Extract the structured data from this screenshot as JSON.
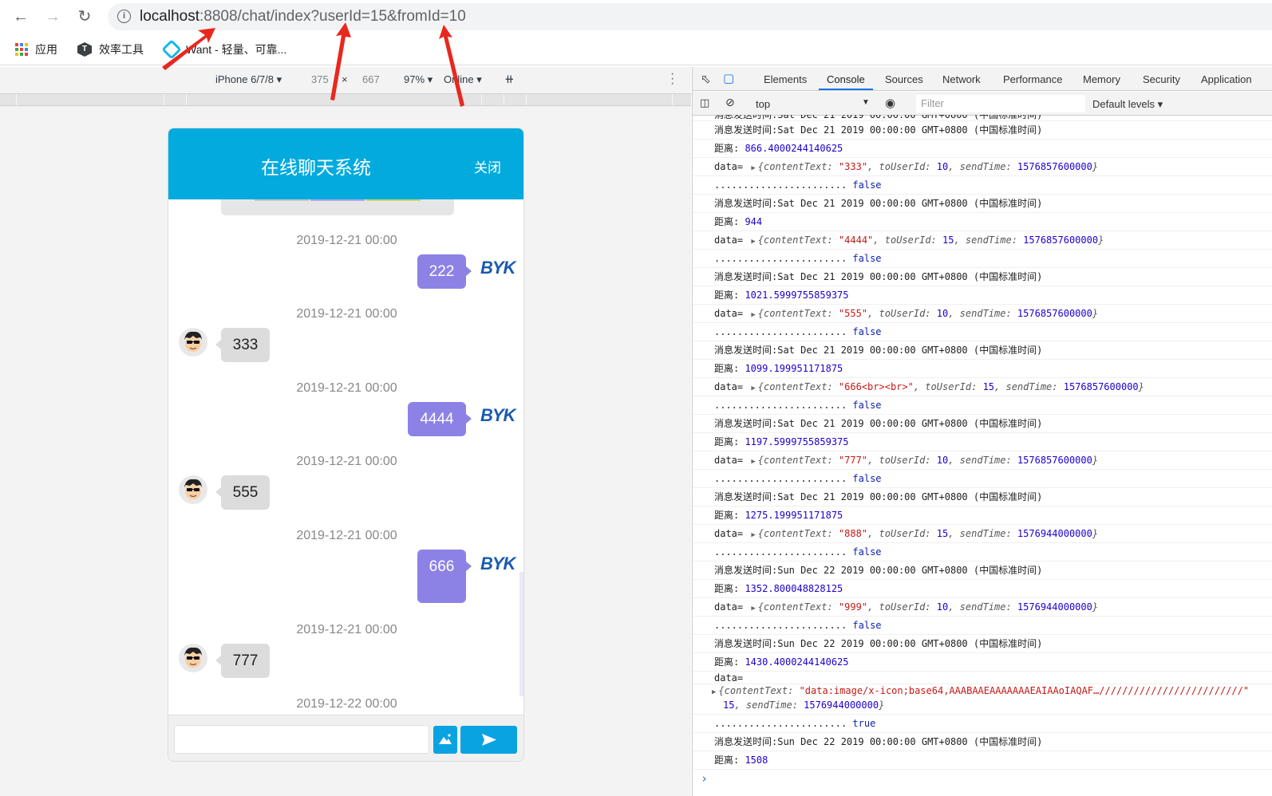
{
  "browser": {
    "url_host": "localhost",
    "url_rest": ":8808/chat/index?userId=15&fromId=10",
    "bookmarks": [
      {
        "label": "应用",
        "icon": "apps-grid-icon"
      },
      {
        "label": "效率工具",
        "icon": "hexagon-t-icon"
      },
      {
        "label": "Want - 轻量、可靠...",
        "icon": "want-logo-icon"
      }
    ]
  },
  "device_toolbar": {
    "device": "iPhone 6/7/8",
    "width": "375",
    "times": "×",
    "height": "667",
    "zoom": "97%",
    "network": "Online"
  },
  "chat": {
    "title": "在线聊天系统",
    "close_label": "关闭",
    "logo_text": "BYK",
    "messages": [
      {
        "time": "2019-12-21 00:00",
        "text": "222",
        "side": "me"
      },
      {
        "time": "2019-12-21 00:00",
        "text": "333",
        "side": "other"
      },
      {
        "time": "2019-12-21 00:00",
        "text": "4444",
        "side": "me"
      },
      {
        "time": "2019-12-21 00:00",
        "text": "555",
        "side": "other"
      },
      {
        "time": "2019-12-21 00:00",
        "text": "666",
        "side": "me"
      },
      {
        "time": "2019-12-21 00:00",
        "text": "777",
        "side": "other"
      },
      {
        "time": "2019-12-22 00:00",
        "text": "",
        "side": "me"
      }
    ]
  },
  "devtools": {
    "tabs": [
      "Elements",
      "Console",
      "Sources",
      "Network",
      "Performance",
      "Memory",
      "Security",
      "Application"
    ],
    "active_tab": "Console",
    "context": "top",
    "filter_placeholder": "Filter",
    "levels": "Default levels",
    "console_lines": [
      {
        "kind": "text",
        "text": "消息发送时间:Sat Dec 21 2019 00:00:00 GMT+0800 (中国标准时间)"
      },
      {
        "kind": "dist",
        "label": "距离: ",
        "value": "866.4000244140625"
      },
      {
        "kind": "data",
        "label": "data= ",
        "content": "\"333\"",
        "toUserId": "10",
        "sendTime": "1576857600000"
      },
      {
        "kind": "dots",
        "dots": ".......................",
        "value": "false"
      },
      {
        "kind": "text",
        "text": "消息发送时间:Sat Dec 21 2019 00:00:00 GMT+0800 (中国标准时间)"
      },
      {
        "kind": "dist",
        "label": "距离: ",
        "value": "944"
      },
      {
        "kind": "data",
        "label": "data= ",
        "content": "\"4444\"",
        "toUserId": "15",
        "sendTime": "1576857600000"
      },
      {
        "kind": "dots",
        "dots": ".......................",
        "value": "false"
      },
      {
        "kind": "text",
        "text": "消息发送时间:Sat Dec 21 2019 00:00:00 GMT+0800 (中国标准时间)"
      },
      {
        "kind": "dist",
        "label": "距离: ",
        "value": "1021.5999755859375"
      },
      {
        "kind": "data",
        "label": "data= ",
        "content": "\"555\"",
        "toUserId": "10",
        "sendTime": "1576857600000"
      },
      {
        "kind": "dots",
        "dots": ".......................",
        "value": "false"
      },
      {
        "kind": "text",
        "text": "消息发送时间:Sat Dec 21 2019 00:00:00 GMT+0800 (中国标准时间)"
      },
      {
        "kind": "dist",
        "label": "距离: ",
        "value": "1099.199951171875"
      },
      {
        "kind": "data",
        "label": "data= ",
        "content": "\"666<br><br>\"",
        "toUserId": "15",
        "sendTime": "1576857600000"
      },
      {
        "kind": "dots",
        "dots": ".......................",
        "value": "false"
      },
      {
        "kind": "text",
        "text": "消息发送时间:Sat Dec 21 2019 00:00:00 GMT+0800 (中国标准时间)"
      },
      {
        "kind": "dist",
        "label": "距离: ",
        "value": "1197.5999755859375"
      },
      {
        "kind": "data",
        "label": "data= ",
        "content": "\"777\"",
        "toUserId": "10",
        "sendTime": "1576857600000"
      },
      {
        "kind": "dots",
        "dots": ".......................",
        "value": "false"
      },
      {
        "kind": "text",
        "text": "消息发送时间:Sat Dec 21 2019 00:00:00 GMT+0800 (中国标准时间)"
      },
      {
        "kind": "dist",
        "label": "距离: ",
        "value": "1275.199951171875"
      },
      {
        "kind": "data",
        "label": "data= ",
        "content": "\"888\"",
        "toUserId": "15",
        "sendTime": "1576944000000"
      },
      {
        "kind": "dots",
        "dots": ".......................",
        "value": "false"
      },
      {
        "kind": "text",
        "text": "消息发送时间:Sun Dec 22 2019 00:00:00 GMT+0800 (中国标准时间)"
      },
      {
        "kind": "dist",
        "label": "距离: ",
        "value": "1352.800048828125"
      },
      {
        "kind": "data",
        "label": "data= ",
        "content": "\"999\"",
        "toUserId": "10",
        "sendTime": "1576944000000"
      },
      {
        "kind": "dots",
        "dots": ".......................",
        "value": "false"
      },
      {
        "kind": "text",
        "text": "消息发送时间:Sun Dec 22 2019 00:00:00 GMT+0800 (中国标准时间)"
      },
      {
        "kind": "dist",
        "label": "距离: ",
        "value": "1430.4000244140625"
      },
      {
        "kind": "datahead",
        "label": "data="
      },
      {
        "kind": "imgdata",
        "content": "\"data:image/x-icon;base64,AAABAAEAAAAAAAEAIAAoIAQAF…/////////////////////////\"",
        "tail_id": "15",
        "sendTime": "1576944000000"
      },
      {
        "kind": "dots",
        "dots": ".......................",
        "value": "true"
      },
      {
        "kind": "text",
        "text": "消息发送时间:Sun Dec 22 2019 00:00:00 GMT+0800 (中国标准时间)"
      },
      {
        "kind": "dist",
        "label": "距离: ",
        "value": "1508"
      }
    ],
    "partial_first_line": "消息发送时间:Sat Dec 21 2019 00:00:00 GMT+0800 (中国标准时间)",
    "prompt": "›"
  }
}
